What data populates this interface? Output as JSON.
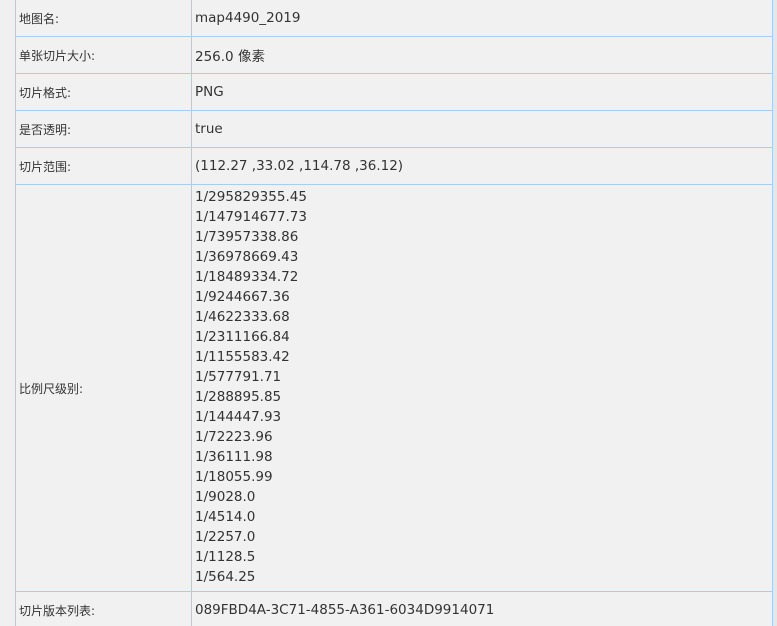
{
  "rows": {
    "map_name": {
      "label": "地图名:",
      "value": "map4490_2019"
    },
    "tile_size": {
      "label": "单张切片大小:",
      "value": "256.0 像素"
    },
    "tile_format": {
      "label": "切片格式:",
      "value": "PNG"
    },
    "transparent": {
      "label": "是否透明:",
      "value": "true"
    },
    "tile_bounds": {
      "label": "切片范围:",
      "value": "(112.27 ,33.02 ,114.78 ,36.12)"
    },
    "scale_levels": {
      "label": "比例尺级别:",
      "values": [
        "1/295829355.45",
        "1/147914677.73",
        "1/73957338.86",
        "1/36978669.43",
        "1/18489334.72",
        "1/9244667.36",
        "1/4622333.68",
        "1/2311166.84",
        "1/1155583.42",
        "1/577791.71",
        "1/288895.85",
        "1/144447.93",
        "1/72223.96",
        "1/36111.98",
        "1/18055.99",
        "1/9028.0",
        "1/4514.0",
        "1/2257.0",
        "1/1128.5",
        "1/564.25"
      ]
    },
    "tile_versions": {
      "label": "切片版本列表:",
      "value": "089FBD4A-3C71-4855-A361-6034D9914071"
    }
  }
}
